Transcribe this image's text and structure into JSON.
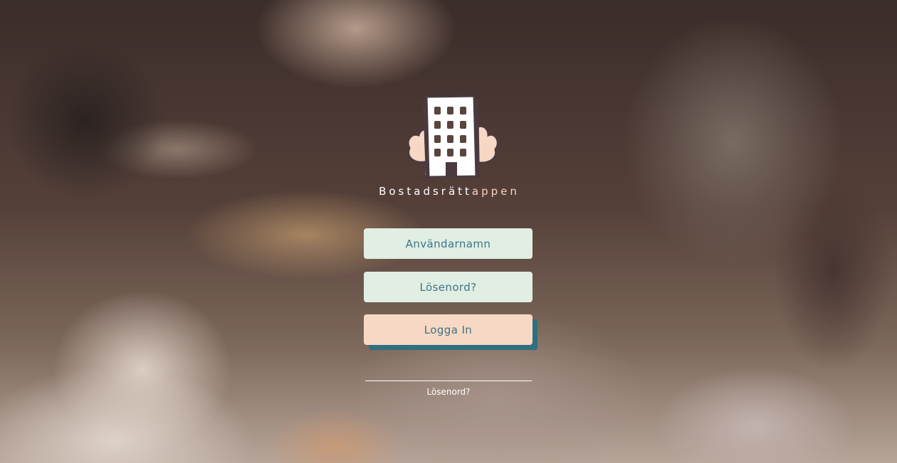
{
  "app": {
    "brand_name": "Bostadsrätt",
    "brand_suffix": "appen",
    "logo_icon": "apartment-building-with-trees-icon"
  },
  "login_form": {
    "username_placeholder": "Användarnamn",
    "password_placeholder": "Lösenord?",
    "login_label": "Logga In",
    "forgot_password_label": "Lösenord?"
  },
  "colors": {
    "field_background": "#e0eee3",
    "field_text": "#3f7484",
    "button_background": "#f6d8c5",
    "button_shadow": "#2e6f80",
    "brand_accent": "#f6d5c3"
  }
}
